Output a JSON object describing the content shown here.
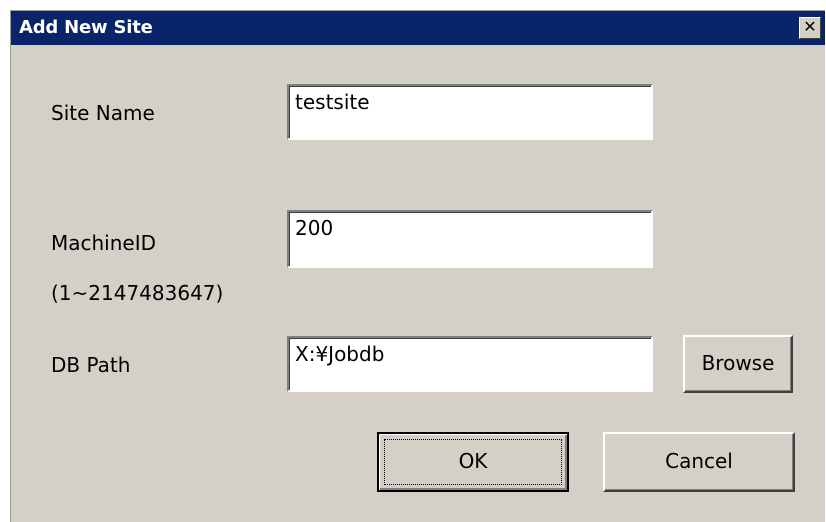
{
  "window": {
    "title": "Add New Site",
    "close_glyph": "✕"
  },
  "form": {
    "site_name_label": "Site Name",
    "site_name_value": "testsite",
    "machine_id_label": "MachineID",
    "machine_id_range": "(1~2147483647)",
    "machine_id_value": "200",
    "db_path_label": "DB Path",
    "db_path_value": "X:¥Jobdb"
  },
  "buttons": {
    "browse": "Browse",
    "ok": "OK",
    "cancel": "Cancel"
  },
  "colors": {
    "titlebar": "#0a246a",
    "dialog_face": "#d4d0c8"
  }
}
